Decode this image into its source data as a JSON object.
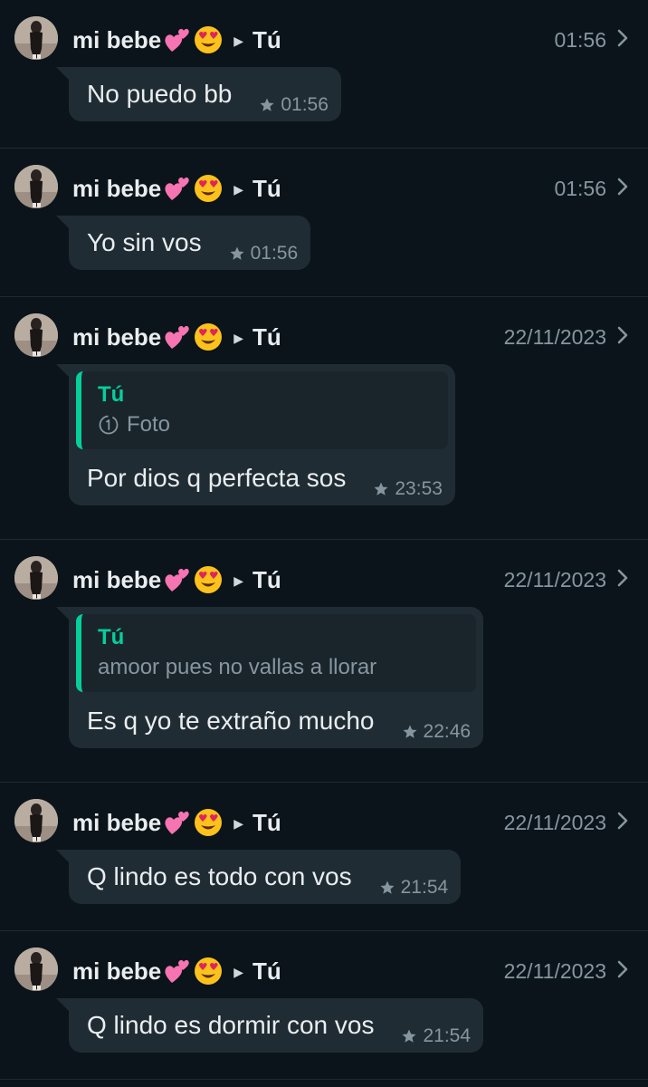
{
  "entries": [
    {
      "sender": "mi bebe",
      "recipient": "Tú",
      "date": "01:56",
      "text": "No puedo bb",
      "time": "01:56"
    },
    {
      "sender": "mi bebe",
      "recipient": "Tú",
      "date": "01:56",
      "text": "Yo sin vos",
      "time": "01:56"
    },
    {
      "sender": "mi bebe",
      "recipient": "Tú",
      "date": "22/11/2023",
      "quote": {
        "author": "Tú",
        "text": "Foto",
        "icon": "view-once-icon"
      },
      "text": "Por dios q perfecta sos",
      "time": "23:53"
    },
    {
      "sender": "mi bebe",
      "recipient": "Tú",
      "date": "22/11/2023",
      "quote": {
        "author": "Tú",
        "text": "amoor pues no vallas a llorar"
      },
      "text": "Es q yo te extraño mucho",
      "time": "22:46"
    },
    {
      "sender": "mi bebe",
      "recipient": "Tú",
      "date": "22/11/2023",
      "text": "Q lindo es todo con vos",
      "time": "21:54"
    },
    {
      "sender": "mi bebe",
      "recipient": "Tú",
      "date": "22/11/2023",
      "text": "Q lindo es dormir con vos",
      "time": "21:54"
    }
  ],
  "icons": {
    "sender_emojis": [
      "two-hearts-emoji",
      "heart-eyes-emoji"
    ],
    "star": "star-icon",
    "chevron": "chevron-right-icon",
    "arrow": "play-arrow-icon"
  },
  "colors": {
    "background": "#0b141a",
    "bubble": "#202c33",
    "accent": "#06cf9c",
    "muted": "#8696a0"
  }
}
